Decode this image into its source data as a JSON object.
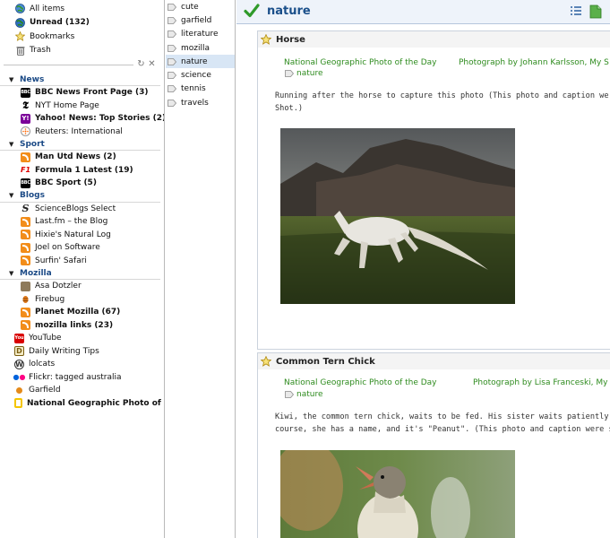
{
  "sidebar": {
    "top": [
      {
        "label": "All items",
        "icon": "globe-icon",
        "bold": false
      },
      {
        "label": "Unread (132)",
        "icon": "unread-globe-icon",
        "bold": true
      },
      {
        "label": "Bookmarks",
        "icon": "star-icon",
        "bold": false
      },
      {
        "label": "Trash",
        "icon": "trash-icon",
        "bold": false
      }
    ],
    "tools": {
      "refresh": "refresh-icon",
      "settings": "tools-icon"
    },
    "folders": [
      {
        "name": "News",
        "feeds": [
          {
            "label": "BBC News Front Page (3)",
            "icon": "bbc-icon",
            "bold": true
          },
          {
            "label": "NYT Home Page",
            "icon": "nyt-icon",
            "bold": false
          },
          {
            "label": "Yahoo! News: Top Stories (2)",
            "icon": "yahoo-icon",
            "bold": true
          },
          {
            "label": "Reuters: International",
            "icon": "reuters-icon",
            "bold": false
          }
        ]
      },
      {
        "name": "Sport",
        "feeds": [
          {
            "label": "Man Utd News (2)",
            "icon": "rss-icon",
            "bold": true
          },
          {
            "label": "Formula 1 Latest (19)",
            "icon": "f1-icon",
            "bold": true
          },
          {
            "label": "BBC Sport (5)",
            "icon": "bbc-icon",
            "bold": true
          }
        ]
      },
      {
        "name": "Blogs",
        "feeds": [
          {
            "label": "ScienceBlogs Select",
            "icon": "scienceblogs-icon",
            "bold": false
          },
          {
            "label": "Last.fm – the Blog",
            "icon": "rss-icon",
            "bold": false
          },
          {
            "label": "Hixie's Natural Log",
            "icon": "rss-icon",
            "bold": false
          },
          {
            "label": "Joel on Software",
            "icon": "rss-icon",
            "bold": false
          },
          {
            "label": "Surfin' Safari",
            "icon": "rss-icon",
            "bold": false
          }
        ]
      },
      {
        "name": "Mozilla",
        "feeds": [
          {
            "label": "Asa Dotzler",
            "icon": "avatar-icon",
            "bold": false
          },
          {
            "label": "Firebug",
            "icon": "firebug-icon",
            "bold": false
          },
          {
            "label": "Planet Mozilla (67)",
            "icon": "rss-icon",
            "bold": true
          },
          {
            "label": "mozilla links (23)",
            "icon": "rss-icon",
            "bold": true
          }
        ]
      }
    ],
    "root_feeds": [
      {
        "label": "YouTube",
        "icon": "youtube-icon",
        "bold": false
      },
      {
        "label": "Daily Writing Tips",
        "icon": "dwt-icon",
        "bold": false
      },
      {
        "label": "lolcats",
        "icon": "wordpress-icon",
        "bold": false
      },
      {
        "label": "Flickr: tagged australia",
        "icon": "flickr-icon",
        "bold": false
      },
      {
        "label": "Garfield",
        "icon": "garfield-icon",
        "bold": false
      },
      {
        "label": "National Geographic Photo of the ...",
        "icon": "natgeo-icon",
        "bold": true
      }
    ]
  },
  "tags": {
    "items": [
      "cute",
      "garfield",
      "literature",
      "mozilla",
      "nature",
      "science",
      "tennis",
      "travels"
    ],
    "selected": "nature"
  },
  "main": {
    "title": "nature",
    "header_icons": [
      "list-view-icon",
      "full-view-icon"
    ],
    "entries": [
      {
        "title": "Horse",
        "source": "National Geographic Photo of the Day",
        "author": "Photograph by Johann Karlsson, My S",
        "tag": "nature",
        "body": [
          "Running after the horse to capture this photo (This photo and caption we",
          "Shot.)"
        ]
      },
      {
        "title": "Common Tern Chick",
        "source": "National Geographic Photo of the Day",
        "author": "Photograph by Lisa Franceski, My",
        "tag": "nature",
        "body": [
          "Kiwi, the common tern chick, waits to be fed. His sister waits patiently in the",
          "course, she has a name, and it's \"Peanut\". (This photo and caption were subm"
        ]
      }
    ]
  },
  "colors": {
    "accent": "#1a4f8a",
    "link_green": "#2e8b1e",
    "selection": "#d8e6f5"
  }
}
